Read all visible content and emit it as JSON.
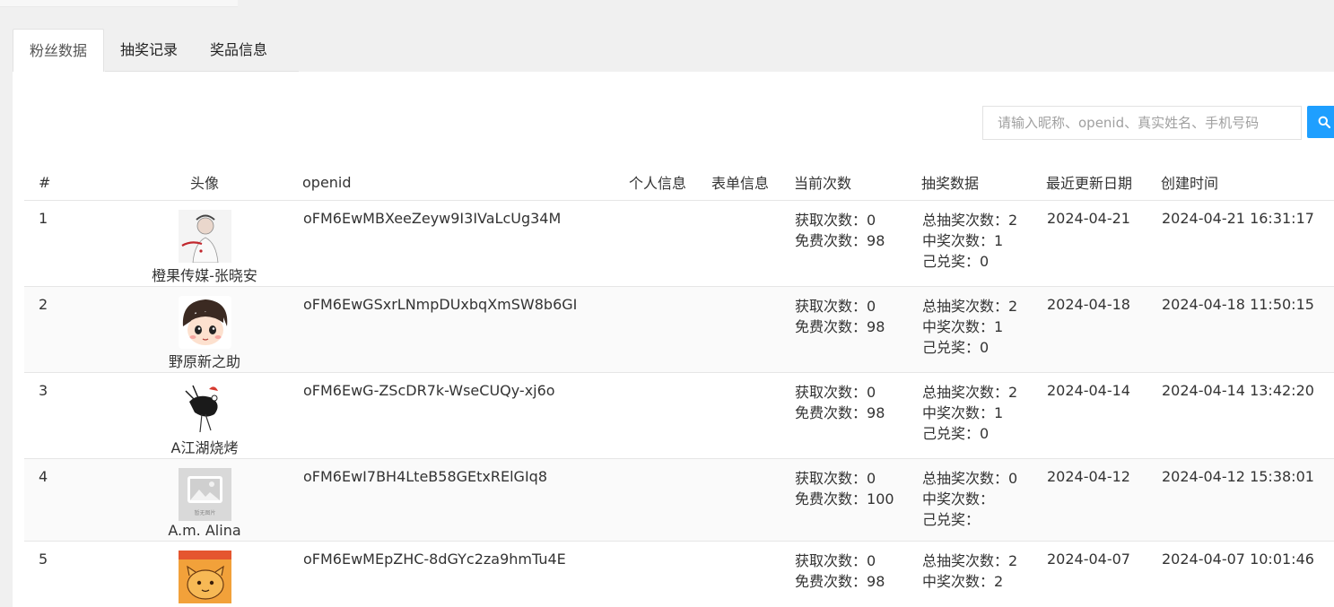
{
  "tabs": [
    {
      "label": "粉丝数据",
      "active": true
    },
    {
      "label": "抽奖记录",
      "active": false
    },
    {
      "label": "奖品信息",
      "active": false
    }
  ],
  "search": {
    "placeholder": "请输入昵称、openid、真实姓名、手机号码",
    "value": "",
    "button_icon": "search-icon",
    "button_color": "#1e9fff"
  },
  "table": {
    "columns": [
      "#",
      "头像",
      "openid",
      "个人信息",
      "表单信息",
      "当前次数",
      "抽奖数据",
      "最近更新日期",
      "创建时间"
    ],
    "labels": {
      "obtained": "获取次数：",
      "free": "免费次数：",
      "total_draws": "总抽奖次数：",
      "wins": "中奖次数：",
      "redeemed": "己兑奖："
    },
    "rows": [
      {
        "index": "1",
        "avatar": "avatar-photo",
        "nickname": "橙果传媒-张晓安",
        "openid": "oFM6EwMBXeeZeyw9I3IVaLcUg34M",
        "personal": "",
        "form": "",
        "obtained": "0",
        "free": "98",
        "total_draws": "2",
        "wins": "1",
        "redeemed": "0",
        "updated": "2024-04-21",
        "created": "2024-04-21 16:31:17"
      },
      {
        "index": "2",
        "avatar": "avatar-cartoon-girl",
        "nickname": "野原新之助",
        "openid": "oFM6EwGSxrLNmpDUxbqXmSW8b6GI",
        "personal": "",
        "form": "",
        "obtained": "0",
        "free": "98",
        "total_draws": "2",
        "wins": "1",
        "redeemed": "0",
        "updated": "2024-04-18",
        "created": "2024-04-18 11:50:15"
      },
      {
        "index": "3",
        "avatar": "avatar-bird-sketch",
        "nickname": "A江湖烧烤",
        "openid": "oFM6EwG-ZScDR7k-WseCUQy-xj6o",
        "personal": "",
        "form": "",
        "obtained": "0",
        "free": "98",
        "total_draws": "2",
        "wins": "1",
        "redeemed": "0",
        "updated": "2024-04-14",
        "created": "2024-04-14 13:42:20"
      },
      {
        "index": "4",
        "avatar": "avatar-placeholder-image",
        "placeholder_text": "暂无图片",
        "nickname": "A.m. Alina",
        "openid": "oFM6EwI7BH4LteB58GEtxRElGIq8",
        "personal": "",
        "form": "",
        "obtained": "0",
        "free": "100",
        "total_draws": "0",
        "wins": "",
        "redeemed": "",
        "updated": "2024-04-12",
        "created": "2024-04-12 15:38:01"
      },
      {
        "index": "5",
        "avatar": "avatar-orange-cat",
        "nickname": "",
        "openid": "oFM6EwMEpZHC-8dGYc2za9hmTu4E",
        "personal": "",
        "form": "",
        "obtained": "0",
        "free": "98",
        "total_draws": "2",
        "wins": "2",
        "redeemed": "",
        "updated": "2024-04-07",
        "created": "2024-04-07 10:01:46"
      }
    ]
  }
}
